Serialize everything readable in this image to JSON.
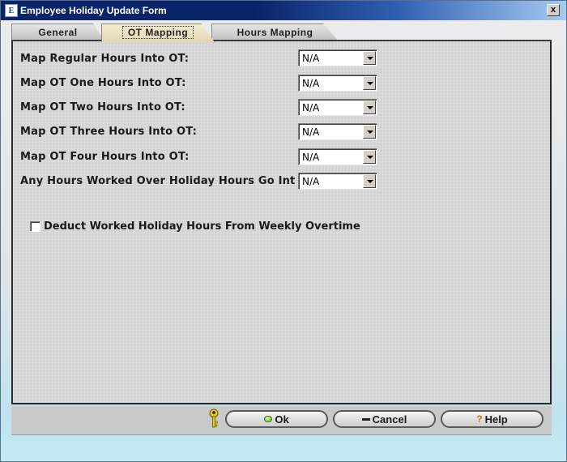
{
  "window": {
    "title": "Employee Holiday Update Form",
    "close_glyph": "x",
    "app_icon_letter": "E"
  },
  "tabs": [
    {
      "label": "General",
      "active": false
    },
    {
      "label": "OT Mapping",
      "active": true
    },
    {
      "label": "Hours Mapping",
      "active": false
    }
  ],
  "mappings": [
    {
      "label": "Map Regular Hours Into OT:",
      "value": "N/A"
    },
    {
      "label": "Map OT One Hours Into OT:",
      "value": "N/A"
    },
    {
      "label": "Map OT Two Hours Into OT:",
      "value": "N/A"
    },
    {
      "label": "Map OT Three Hours Into OT:",
      "value": "N/A"
    },
    {
      "label": "Map OT Four Hours Into OT:",
      "value": "N/A"
    },
    {
      "label": "Any Hours Worked Over Holiday Hours Go Into OT:",
      "value": "N/A"
    }
  ],
  "deduct_checkbox": {
    "label": "Deduct Worked Holiday Hours From Weekly Overtime",
    "checked": false
  },
  "buttons": {
    "ok": "Ok",
    "cancel": "Cancel",
    "help": "Help",
    "help_glyph": "?"
  },
  "icons": {
    "key": "key-icon",
    "ok": "ok-icon",
    "cancel": "minus-icon",
    "help": "question-icon"
  }
}
